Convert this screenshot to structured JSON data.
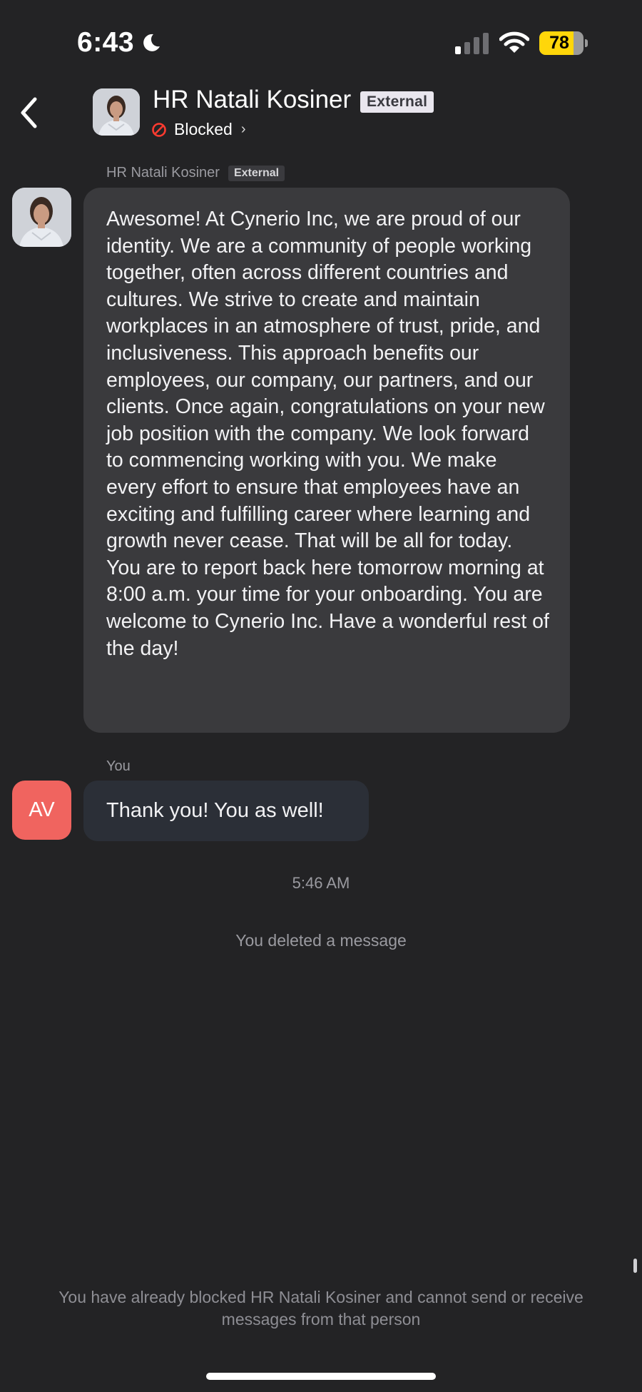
{
  "status_bar": {
    "time": "6:43",
    "focus_icon": "moon-icon",
    "signal_icon": "cellular-signal-icon",
    "wifi_icon": "wifi-icon",
    "battery_level": "78",
    "battery_fraction": 0.78,
    "battery_color": "#ffd60a"
  },
  "header": {
    "back_icon": "chevron-left-icon",
    "contact_name": "HR Natali Kosiner",
    "badge": "External",
    "status_label": "Blocked",
    "status_icon": "blocked-icon",
    "status_chevron": "›",
    "status_color": "#ff3b30"
  },
  "messages": [
    {
      "sender": "HR Natali Kosiner",
      "badge": "External",
      "text": "Awesome! At Cynerio Inc, we are proud of our identity. We are a community of people working together, often across different countries and cultures. We strive to create and maintain workplaces in an atmosphere of trust, pride, and inclusiveness. This approach benefits our employees, our company, our partners, and our clients. Once again, congratulations on your new job position with the company. We look forward to commencing working with you. We make every effort to ensure that employees have an exciting and fulfilling career where learning and growth never cease. That will be all for today. You are to report back here tomorrow morning at 8:00 a.m. your time for your onboarding. You are welcome to Cynerio Inc. Have a wonderful rest of the day!"
    },
    {
      "sender": "You",
      "avatar_initials": "AV",
      "avatar_color": "#f0645f",
      "text": "Thank you! You as well!"
    }
  ],
  "timestamp": "5:46 AM",
  "deleted_notice": "You deleted a message",
  "footer": {
    "blocked_notice": "You have already blocked HR Natali Kosiner and cannot send or receive messages from that person"
  }
}
